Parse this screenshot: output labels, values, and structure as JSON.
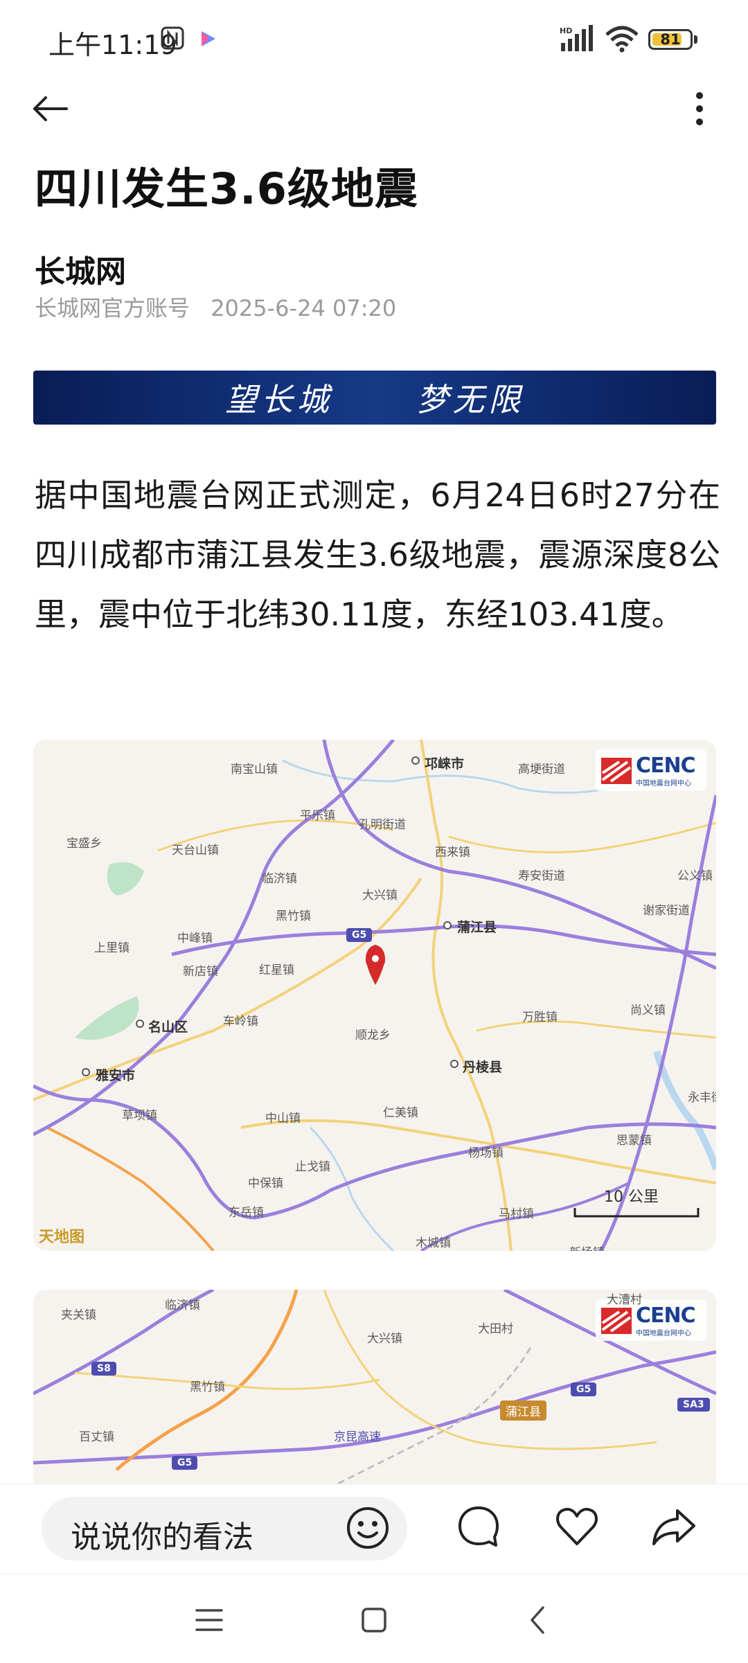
{
  "status_bar": {
    "time": "上午11:19",
    "battery_level": "81",
    "battery_fraction": 0.81,
    "network": "HD"
  },
  "article": {
    "title": "四川发生3.6级地震",
    "author": "长城网",
    "account_type": "长城网官方账号",
    "published": "2025-6-24 07:20",
    "banner_left": "望长城",
    "banner_right": "梦无限",
    "body": "据中国地震台网正式测定，6月24日6时27分在四川成都市蒲江县发生3.6级地震，震源深度8公里，震中位于北纬30.11度，东经103.41度。"
  },
  "map1": {
    "logo": "CENC",
    "logo_sub": "中国地震台网中心",
    "scale": "10 公里",
    "watermark": "天地图",
    "places": {
      "nanbaoshan": "南宝山镇",
      "qionglai": "邛崃市",
      "gaohe": "高埂街道",
      "pingle": "平乐镇",
      "kongming": "孔明街道",
      "baoxing": "宝盛乡",
      "tiantaishan": "天台山镇",
      "xilai": "西来镇",
      "shouan": "寿安街道",
      "gongyi": "公义镇",
      "linji": "临济镇",
      "daxing": "大兴镇",
      "xiejia": "谢家街道",
      "heizhu": "黑竹镇",
      "pujiang": "蒲江县",
      "shangli": "上里镇",
      "zhongfeng": "中峰镇",
      "hongxing": "红星镇",
      "xindian": "新店镇",
      "wansheng": "万胜镇",
      "shangyi": "尚义镇",
      "mingshan": "名山区",
      "cheling": "车岭镇",
      "shunlong": "顺龙乡",
      "yaan": "雅安市",
      "danleng": "丹棱县",
      "yongfeng": "永丰街",
      "caoba": "草坝镇",
      "zhongshan": "中山镇",
      "renmei": "仁美镇",
      "siming": "思蒙镇",
      "yangchang": "杨场镇",
      "zhongbao": "中保镇",
      "zhilong": "止戈镇",
      "dongyue": "东岳镇",
      "macun": "马村镇",
      "muchang": "木城镇",
      "xinfeng": "新场镇",
      "g5": "G5"
    }
  },
  "map2": {
    "logo": "CENC",
    "logo_sub": "中国地震台网中心",
    "places": {
      "jiaguan": "夹关镇",
      "linji": "临济镇",
      "dacao": "大漕村",
      "datian": "大田村",
      "daxing": "大兴镇",
      "heizhu": "黑竹镇",
      "baizhang": "百丈镇",
      "pujiang": "蒲江县",
      "jingkun": "京昆高速",
      "s8": "S8",
      "g5a": "G5",
      "g5b": "G5",
      "sa3": "SA3"
    }
  },
  "bottom_bar": {
    "comment_placeholder": "说说你的看法"
  },
  "colors": {
    "banner": "#12317a",
    "highway": "#9b7fdc",
    "provincial_road": "#f0c060",
    "epicenter": "#d42a2a",
    "cenc": "#1b3f8f"
  }
}
